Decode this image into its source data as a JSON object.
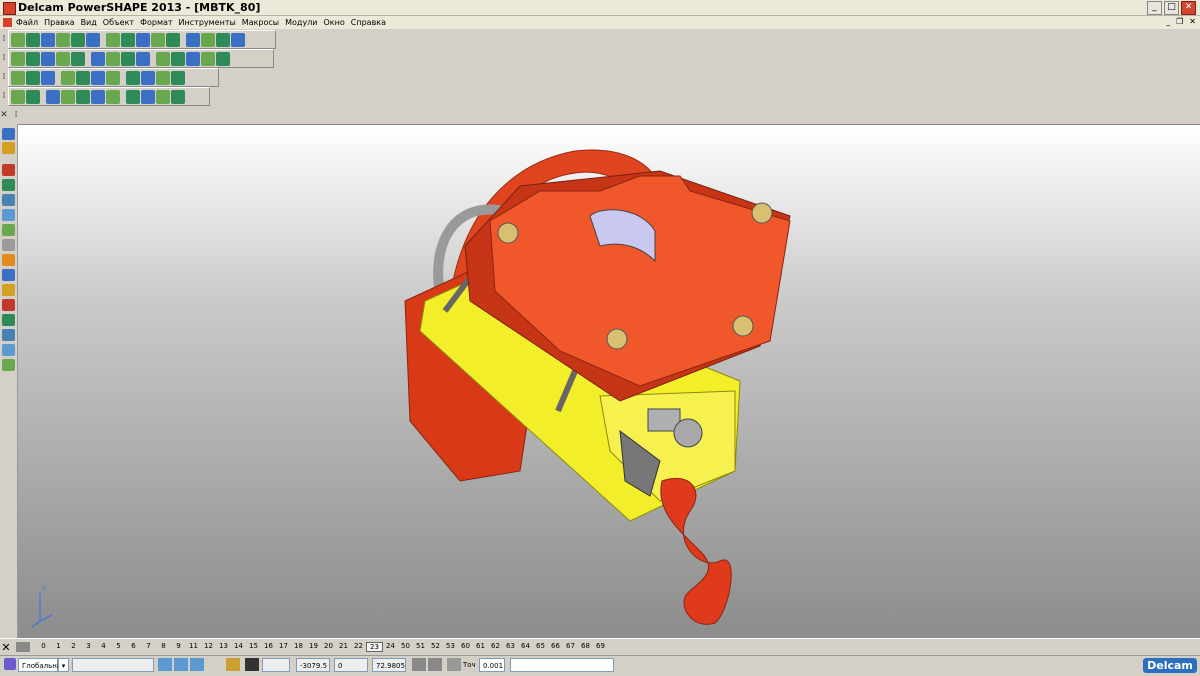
{
  "window": {
    "title": "Delcam PowerSHAPE 2013 - [MBTK_80]"
  },
  "menu": [
    "Файл",
    "Правка",
    "Вид",
    "Объект",
    "Формат",
    "Инструменты",
    "Макросы",
    "Модули",
    "Окно",
    "Справка"
  ],
  "levels": {
    "items": [
      "0",
      "1",
      "2",
      "3",
      "4",
      "5",
      "6",
      "7",
      "8",
      "9",
      "11",
      "12",
      "13",
      "14",
      "15",
      "16",
      "17",
      "18",
      "19",
      "20",
      "21",
      "22",
      "23",
      "24",
      "50",
      "51",
      "52",
      "53",
      "60",
      "61",
      "62",
      "63",
      "64",
      "65",
      "66",
      "67",
      "68",
      "69"
    ],
    "active": "23"
  },
  "status": {
    "workplane": "Глобальна",
    "x": "-3079.5",
    "y": "0",
    "z": "72.9805",
    "tolerance_label": "Точ",
    "tolerance": "0.001"
  },
  "brand": "Delcam",
  "axis": {
    "y_label": "Y"
  },
  "colors": {
    "part_red": "#e8451f",
    "plate_yellow": "#f2ee2a",
    "metal_grey": "#a8a8a8"
  }
}
